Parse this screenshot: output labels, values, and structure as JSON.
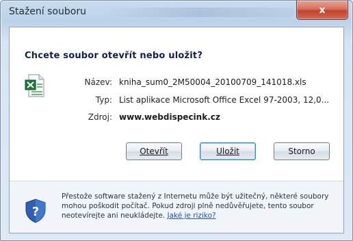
{
  "window": {
    "title": "Stažení souboru",
    "close_label": "x"
  },
  "dialog": {
    "heading": "Chcete soubor otevřít nebo uložit?",
    "file_icon": "excel-file-icon",
    "fields": [
      {
        "label": "Název:",
        "value": "kniha_sum0_2M50004_20100709_141018.xls"
      },
      {
        "label": "Typ:",
        "value": "List aplikace Microsoft Office Excel 97-2003, 12,0..."
      },
      {
        "label": "Zdroj:",
        "value": "www.webdispecink.cz"
      }
    ],
    "buttons": {
      "open": "Otevřít",
      "save": "Uložit",
      "cancel": "Storno"
    }
  },
  "footer": {
    "icon": "shield-question-icon",
    "warning_text": "Přestože software stažený z Internetu může být užitečný, některé soubory mohou poškodit počítač. Pokud zdroji plně nedůvěřujete, tento soubor neotevírejte ani neukládejte.",
    "link_text": "Jaké je riziko?"
  },
  "colors": {
    "accent": "#1a4fc9",
    "close": "#c0432c"
  }
}
